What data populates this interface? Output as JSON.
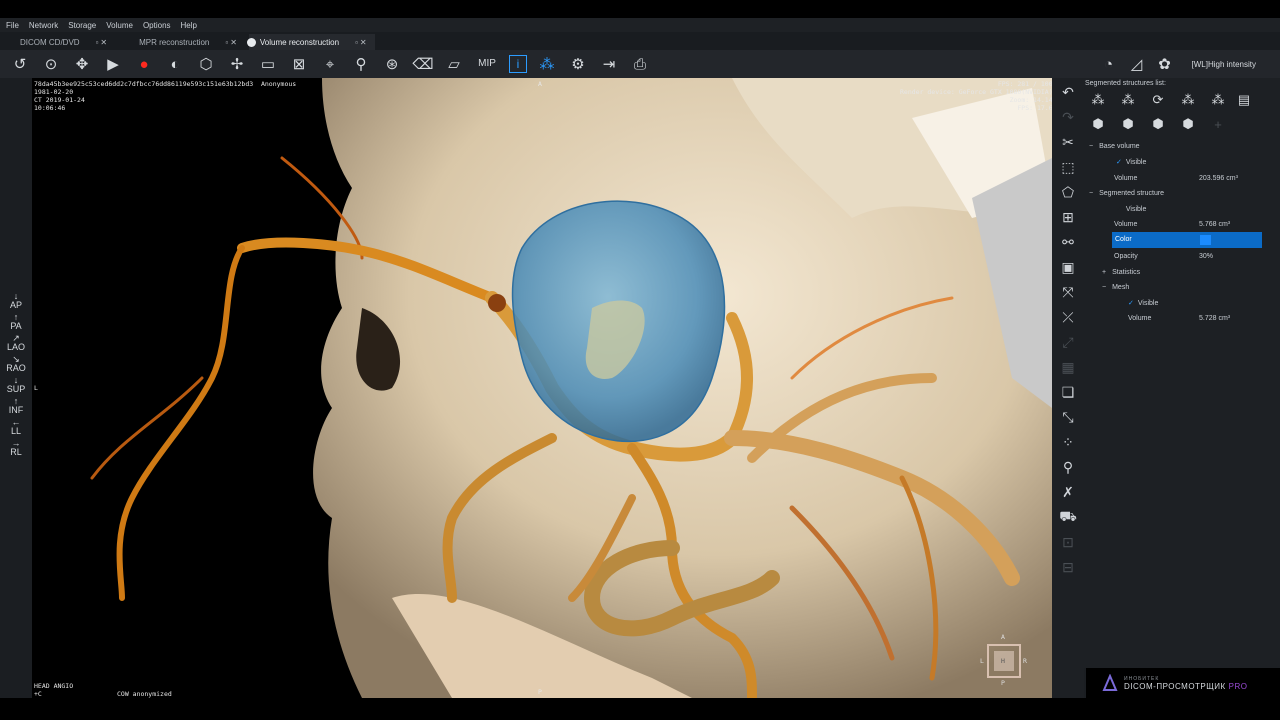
{
  "menu": [
    "File",
    "Network",
    "Storage",
    "Volume",
    "Options",
    "Help"
  ],
  "tabs": [
    {
      "label": "DICOM CD/DVD",
      "active": false
    },
    {
      "label": "MPR reconstruction",
      "active": false
    },
    {
      "label": "Volume reconstruction",
      "active": true
    }
  ],
  "toolbar": {
    "mip_label": "MIP",
    "wl_preset": "[WL]High intensity"
  },
  "orientation_buttons": [
    "AP",
    "PA",
    "LAO",
    "RAO",
    "SUP",
    "INF",
    "LL",
    "RL"
  ],
  "viewport": {
    "top_left_info": "78da45b3ee925c53ced6dd2c7dfbcc76dd86119e593c151e63b12bd3  Anonymous\n1981-02-20\nCT 2019-01-24\n10:06:46",
    "top_right_info": "FPS: 281 / 100\nRender device: GeForce GTX 1080(NVIDIA)\nZoom: 14.14\nFPS: 17.6",
    "bottom_left_info": "HEAD ANGIO\n+C",
    "bottom_center_info": "COW anonymized",
    "marker_top": "A",
    "marker_left": "L",
    "marker_bottom": "P",
    "cube_labels": {
      "top": "A",
      "left": "L",
      "center": "H",
      "right": "R",
      "bottom": "P"
    }
  },
  "panel": {
    "header": "Segmented structures list:",
    "tree": {
      "base_volume": {
        "label": "Base volume",
        "visible_label": "Visible",
        "volume_label": "Volume",
        "volume_value": "203.596 cm³"
      },
      "segmented_structure": {
        "label": "Segmented structure",
        "visible_label": "Visible",
        "volume_label": "Volume",
        "volume_value": "5.768 cm³",
        "color_label": "Color",
        "opacity_label": "Opacity",
        "opacity_value": "30%"
      },
      "statistics": {
        "label": "Statistics"
      },
      "mesh": {
        "label": "Mesh",
        "visible_label": "Visible",
        "volume_label": "Volume",
        "volume_value": "5.728 cm³"
      }
    },
    "colors": {
      "selected_row": "#0b6bc7",
      "swatch": "#1b8bff"
    }
  },
  "logo": {
    "small": "ИНОБИТЕК",
    "big": "DICOM-ПРОСМОТРЩИК",
    "pro": "PRO"
  }
}
